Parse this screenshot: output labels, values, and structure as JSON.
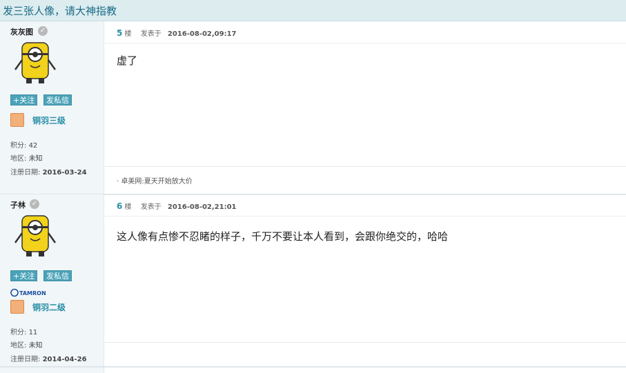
{
  "thread": {
    "title": "发三张人像，请大神指教"
  },
  "posts": [
    {
      "username": "灰灰图",
      "follow_label": "+关注",
      "pm_label": "发私信",
      "level": "铜羽三级",
      "stats": {
        "points_label": "积分:",
        "points": "42",
        "region_label": "地区:",
        "region": "未知",
        "reg_label": "注册日期:",
        "reg_date": "2016-03-24"
      },
      "floor": "5",
      "floor_unit": "楼",
      "posted_label": "发表于",
      "time": "2016-08-02,09:17",
      "content": "虚了",
      "signature": "· 卓美网:夏天开始放大价"
    },
    {
      "username": "子林",
      "follow_label": "+关注",
      "pm_label": "发私信",
      "badge": "TAMRON",
      "level": "铜羽二级",
      "stats": {
        "points_label": "积分:",
        "points": "11",
        "region_label": "地区:",
        "region": "未知",
        "reg_label": "注册日期:",
        "reg_date": "2014-04-26"
      },
      "floor": "6",
      "floor_unit": "楼",
      "posted_label": "发表于",
      "time": "2016-08-02,21:01",
      "content": "这人像有点惨不忍睹的样子，千万不要让本人看到，会跟你绝交的，哈哈"
    }
  ],
  "icons": {
    "verified": "check-badge-icon",
    "avatar": "yellow-minion-avatar",
    "level": "feather-level-icon",
    "brand": "tamron-logo-icon"
  },
  "colors": {
    "header_bg": "#dcecef",
    "accent": "#2a8fa6",
    "button_bg": "#4aa3b8",
    "sidebar_bg": "#f1f6f9"
  }
}
